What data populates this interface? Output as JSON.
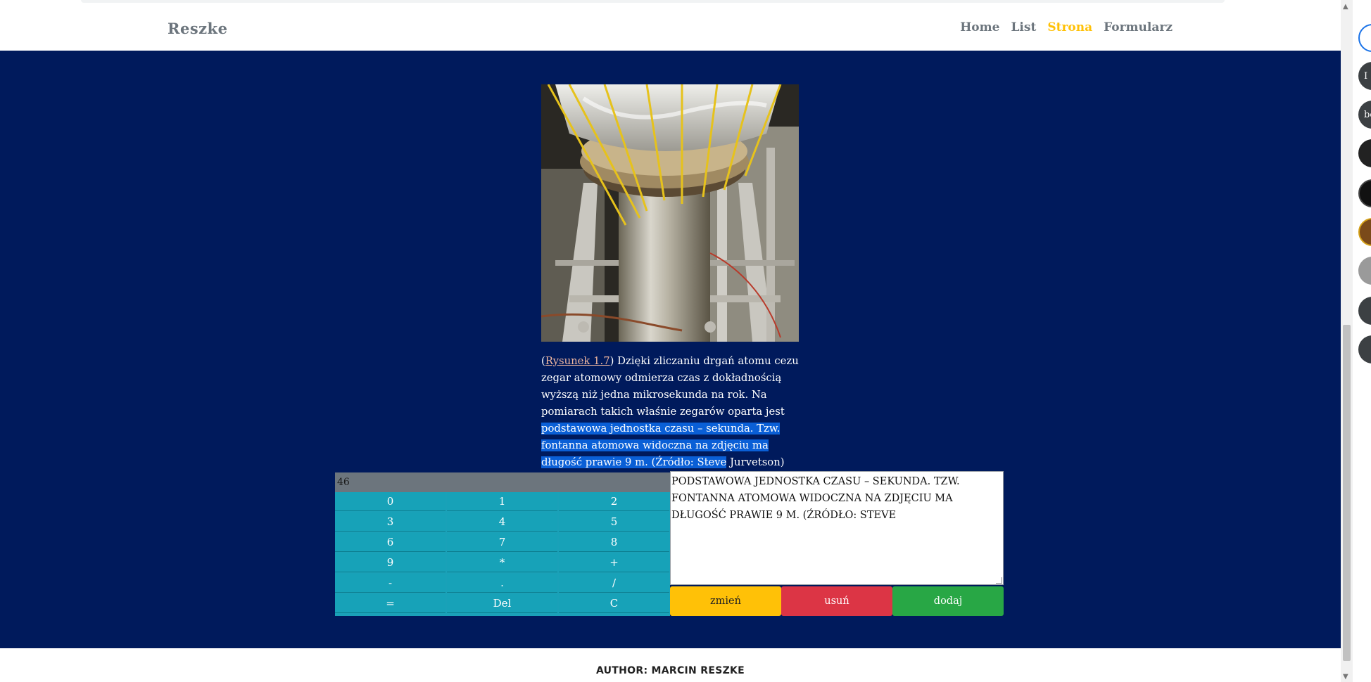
{
  "nav": {
    "brand": "Reszke",
    "items": [
      "Home",
      "List",
      "Strona",
      "Formularz"
    ],
    "active": "Strona"
  },
  "figure": {
    "link_text": "Rysunek 1.7",
    "caption_before": "Dzięki zliczaniu drgań atomu cezu zegar atomowy odmierza czas z dokładnością wyższą niż jedna mikrosekunda na rok. Na pomiarach takich właśnie zegarów oparta jest ",
    "caption_selected": "podstawowa jednostka czasu – sekunda. Tzw. fontanna atomowa widoczna na zdjęciu ma długość prawie 9 m. (Źródło: Steve",
    "caption_after": " Jurvetson)"
  },
  "calculator": {
    "display": "46",
    "keys": [
      "0",
      "1",
      "2",
      "3",
      "4",
      "5",
      "6",
      "7",
      "8",
      "9",
      "*",
      "+",
      "-",
      ".",
      "/",
      "=",
      "Del",
      "C"
    ]
  },
  "editor": {
    "text": "podstawowa jednostka czasu – sekunda. Tzw. fontanna atomowa widoczna na zdjęciu ma długość prawie 9 m. (Źródło: Steve"
  },
  "buttons": {
    "change": "zmień",
    "delete": "usuń",
    "add": "dodaj"
  },
  "footer": {
    "author": "Author: Marcin Reszke"
  },
  "side_panel": [
    "",
    "I",
    "be"
  ],
  "colors": {
    "main_bg": "#001a5c",
    "accent": "#ffc107",
    "key": "#17a2b8",
    "danger": "#dc3545",
    "success": "#28a745"
  }
}
